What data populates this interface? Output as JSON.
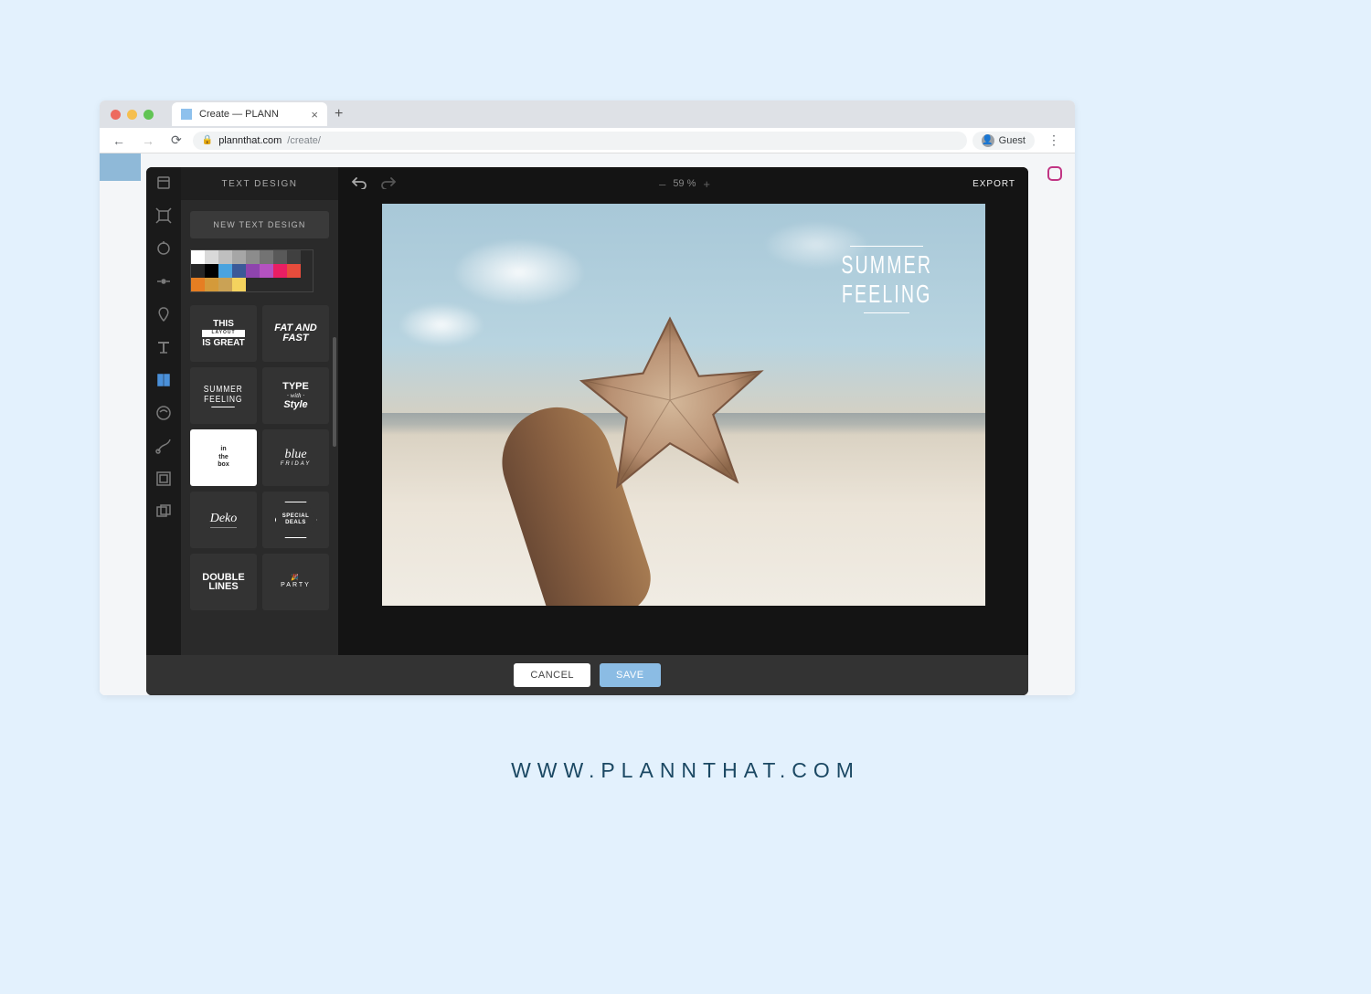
{
  "browser": {
    "tab_title": "Create — PLANN",
    "url_domain": "plannthat.com",
    "url_path": "/create/",
    "guest_label": "Guest"
  },
  "editor": {
    "panel_title": "TEXT DESIGN",
    "new_text_label": "NEW TEXT DESIGN",
    "zoom_value": "59 %",
    "export_label": "EXPORT",
    "cancel_label": "CANCEL",
    "save_label": "SAVE",
    "overlay_line1": "SUMMER",
    "overlay_line2": "FEELING"
  },
  "swatches_row1": [
    "#ffffff",
    "#d9d9d9",
    "#bfbfbf",
    "#a6a6a6",
    "#8c8c8c",
    "#737373",
    "#595959",
    "#404040",
    "#262626",
    "#000000"
  ],
  "swatches_row2": [
    "#4aa3df",
    "#3b5998",
    "#8e44ad",
    "#b452c0",
    "#e91e63",
    "#e74c3c",
    "#e67e22",
    "#d49a3a",
    "#caa255",
    "#f4d35e"
  ],
  "templates": [
    {
      "id": "this-layout",
      "line1": "THIS",
      "sub": "LAYOUT",
      "line2": "IS GREAT",
      "cls": "tpl-this"
    },
    {
      "id": "fat-fast",
      "line1": "FAT AND",
      "line2": "FAST",
      "cls": "tpl-fat"
    },
    {
      "id": "summer-feeling",
      "line1": "SUMMER",
      "line2": "FEELING",
      "cls": "tpl-sf"
    },
    {
      "id": "type-style",
      "line1": "TYPE",
      "mid": "with",
      "line2": "Style",
      "cls": "tpl-type"
    },
    {
      "id": "in-the-box",
      "line1": "in",
      "mid": "the",
      "line2": "box",
      "cls": "tpl-box",
      "white": true
    },
    {
      "id": "blue-friday",
      "line1": "blue",
      "line2": "FRIDAY",
      "cls": "tpl-blue"
    },
    {
      "id": "deko",
      "line1": "Deko",
      "cls": "tpl-deko"
    },
    {
      "id": "special-deals",
      "line1": "SPECIAL",
      "line2": "DEALS",
      "cls": "tpl-deals"
    },
    {
      "id": "double-lines",
      "line1": "DOUBLE",
      "line2": "LINES",
      "cls": "tpl-dbl"
    },
    {
      "id": "party",
      "line1": "PARTY",
      "cls": "tpl-party"
    }
  ],
  "rail_icons": [
    "library",
    "transform",
    "adjust",
    "focus",
    "filter",
    "text",
    "text-design",
    "sticker",
    "brush",
    "frame",
    "overlay"
  ],
  "footer_url": "WWW.PLANNTHAT.COM"
}
